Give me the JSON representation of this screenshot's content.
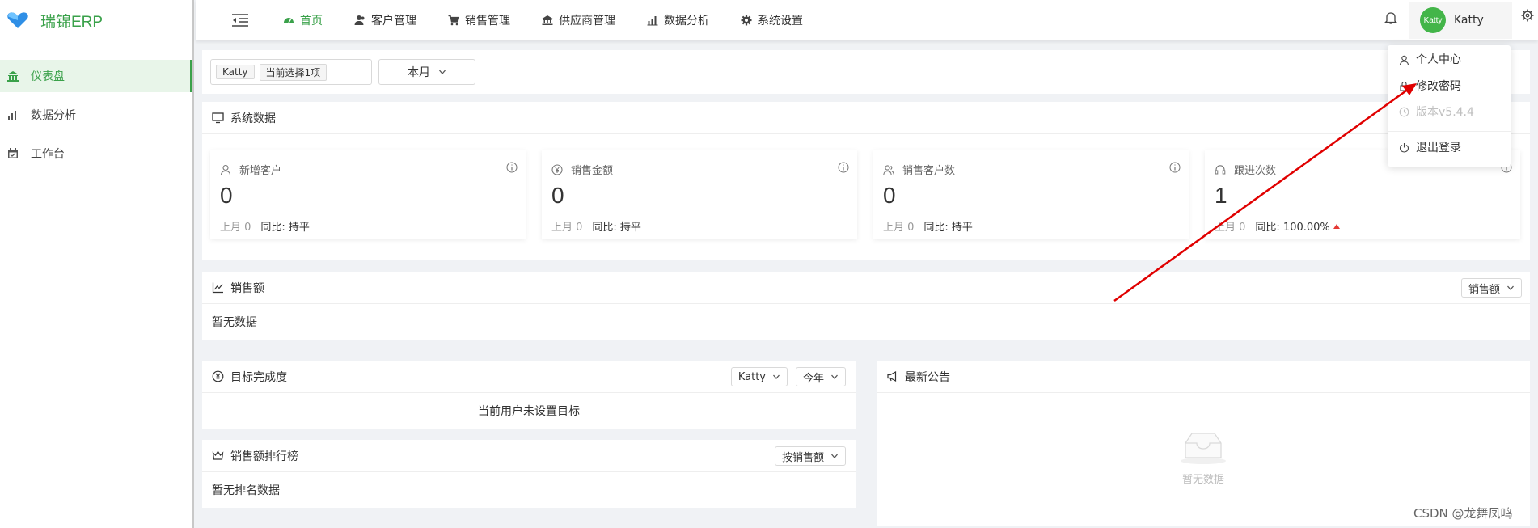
{
  "app": {
    "title": "瑞锦ERP"
  },
  "sidebar": {
    "items": [
      {
        "label": "仪表盘",
        "icon": "bank-icon",
        "active": true
      },
      {
        "label": "数据分析",
        "icon": "bar-chart-icon",
        "active": false
      },
      {
        "label": "工作台",
        "icon": "calendar-icon",
        "active": false
      }
    ]
  },
  "nav": {
    "items": [
      {
        "label": "首页",
        "icon": "dashboard-icon",
        "active": true
      },
      {
        "label": "客户管理",
        "icon": "users-icon",
        "active": false
      },
      {
        "label": "销售管理",
        "icon": "cart-icon",
        "active": false
      },
      {
        "label": "供应商管理",
        "icon": "bank-icon",
        "active": false
      },
      {
        "label": "数据分析",
        "icon": "bar-chart-icon",
        "active": false
      },
      {
        "label": "系统设置",
        "icon": "gear-icon",
        "active": false
      }
    ]
  },
  "user": {
    "avatar_text": "Katty",
    "name": "Katty"
  },
  "filter": {
    "tag": "Katty",
    "count_text": "当前选择1项",
    "period": "本月"
  },
  "system_data": {
    "title": "系统数据",
    "cards": [
      {
        "title": "新增客户",
        "icon": "user-icon",
        "value": "0",
        "last_label": "上月 0",
        "compare_label": "同比: 持平",
        "trend_up": false
      },
      {
        "title": "销售金额",
        "icon": "yen-icon",
        "value": "0",
        "last_label": "上月 0",
        "compare_label": "同比: 持平",
        "trend_up": false
      },
      {
        "title": "销售客户数",
        "icon": "users-icon",
        "value": "0",
        "last_label": "上月 0",
        "compare_label": "同比: 持平",
        "trend_up": false
      },
      {
        "title": "跟进次数",
        "icon": "headset-icon",
        "value": "1",
        "last_label": "上月 0",
        "compare_label": "同比: 100.00%",
        "trend_up": true
      }
    ]
  },
  "sales": {
    "title": "销售额",
    "select": "销售额",
    "empty": "暂无数据"
  },
  "target": {
    "title": "目标完成度",
    "user_select": "Katty",
    "period_select": "今年",
    "empty": "当前用户未设置目标"
  },
  "ranking": {
    "title": "销售额排行榜",
    "select": "按销售额",
    "empty": "暂无排名数据"
  },
  "notice": {
    "title": "最新公告",
    "empty": "暂无数据"
  },
  "dropdown": {
    "items": [
      {
        "label": "个人中心",
        "icon": "user-icon",
        "disabled": false
      },
      {
        "label": "修改密码",
        "icon": "lock-icon",
        "disabled": false
      },
      {
        "label": "版本v5.4.4",
        "icon": "clock-icon",
        "disabled": true
      },
      {
        "label": "退出登录",
        "icon": "power-icon",
        "disabled": false
      }
    ]
  },
  "watermark": "CSDN @龙舞凤鸣",
  "colors": {
    "accent": "#3aa14a",
    "arrow": "#e00000"
  }
}
